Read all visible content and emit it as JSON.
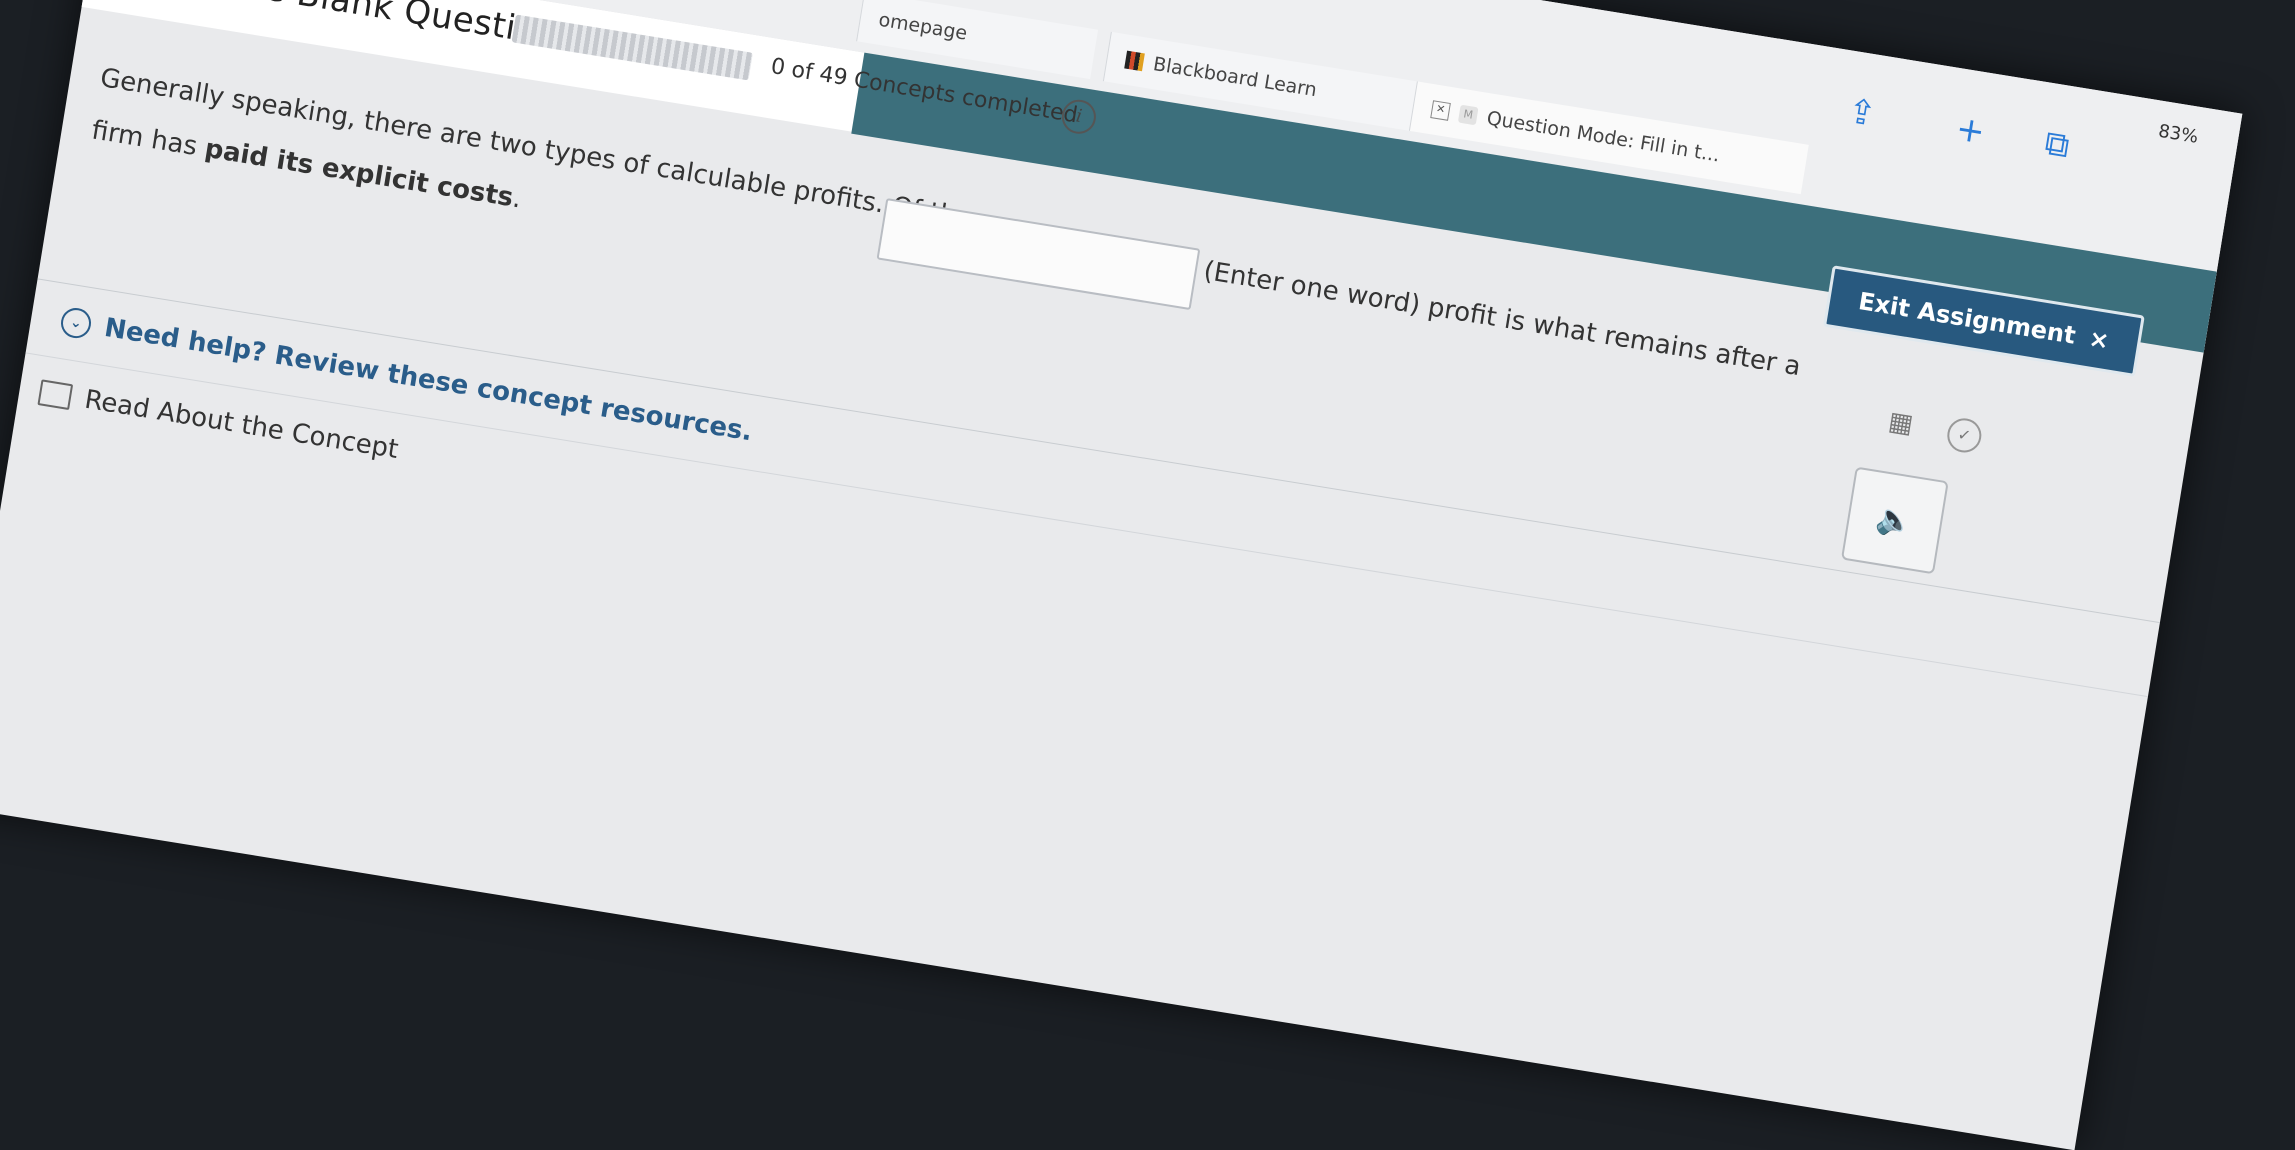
{
  "browser": {
    "status": "83%",
    "tabs": [
      {
        "label": "omepage"
      },
      {
        "label": "Blackboard Learn"
      },
      {
        "label": "Question Mode: Fill in t..."
      }
    ]
  },
  "header": {
    "title": "Fill in the Blank Question",
    "concepts_completed": "0 of 49 Concepts completed",
    "exit_label": "Exit Assignment",
    "exit_icon": "×"
  },
  "question": {
    "part1": "Generally speaking, there are two types of calculable profits. Of these,",
    "answer_value": "",
    "part2": "(Enter one word) profit is what remains after a",
    "line2_prefix": "firm has ",
    "line2_bold": "paid its explicit costs",
    "line2_suffix": "."
  },
  "help": {
    "toggle_label": "Need help? Review these concept resources.",
    "read_label": "Read About the Concept"
  },
  "colors": {
    "teal": "#3c6f7c",
    "exit_bg": "#28597f",
    "help_text": "#2a5d8a"
  }
}
